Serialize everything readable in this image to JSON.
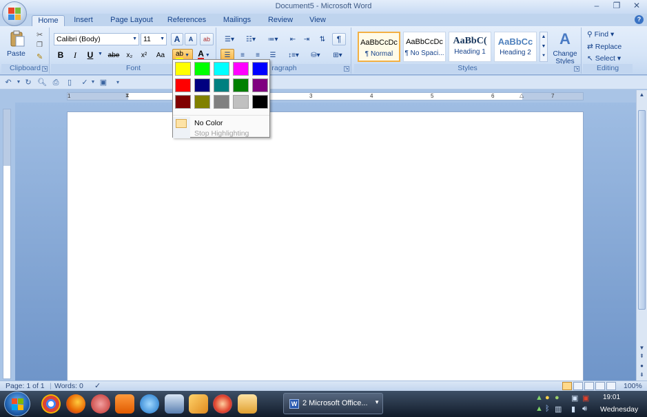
{
  "window": {
    "title": "Document5 - Microsoft Word",
    "min_glyph": "–",
    "restore_glyph": "❐",
    "close_glyph": "✕"
  },
  "tabs": [
    "Home",
    "Insert",
    "Page Layout",
    "References",
    "Mailings",
    "Review",
    "View"
  ],
  "ribbon": {
    "clipboard": {
      "label": "Clipboard",
      "paste": "Paste"
    },
    "font": {
      "label": "Font",
      "font_name": "Calibri (Body)",
      "font_size": "11",
      "bold": "B",
      "italic": "I",
      "underline": "U",
      "strike": "abe",
      "subscript": "x₂",
      "superscript": "x²",
      "change_case": "Aa",
      "grow": "A",
      "shrink": "A"
    },
    "paragraph": {
      "label": "ragraph"
    },
    "styles": {
      "label": "Styles",
      "items": [
        {
          "sample": "AaBbCcDc",
          "name": "¶ Normal"
        },
        {
          "sample": "AaBbCcDc",
          "name": "¶ No Spaci..."
        },
        {
          "sample": "AaBbC(",
          "name": "Heading 1"
        },
        {
          "sample": "AaBbCc",
          "name": "Heading 2"
        }
      ],
      "change_styles": "Change Styles"
    },
    "editing": {
      "label": "Editing",
      "find": "Find",
      "replace": "Replace",
      "select": "Select"
    }
  },
  "highlight_menu": {
    "colors": [
      [
        "#ffff00",
        "#00ff00",
        "#00ffff",
        "#ff00ff",
        "#0000ff"
      ],
      [
        "#ff0000",
        "#000080",
        "#008080",
        "#008000",
        "#800080"
      ],
      [
        "#800000",
        "#808000",
        "#808080",
        "#c0c0c0",
        "#000000"
      ]
    ],
    "no_color": "No Color",
    "stop_highlighting": "Stop Highlighting"
  },
  "ruler": {
    "numbers": [
      "1",
      "1",
      "2",
      "3",
      "4",
      "5",
      "6",
      "7"
    ]
  },
  "status": {
    "page": "Page: 1 of 1",
    "words": "Words: 0",
    "zoom": "100%"
  },
  "taskbar": {
    "task": "2 Microsoft Office...",
    "time": "19:01",
    "day": "Wednesday"
  }
}
